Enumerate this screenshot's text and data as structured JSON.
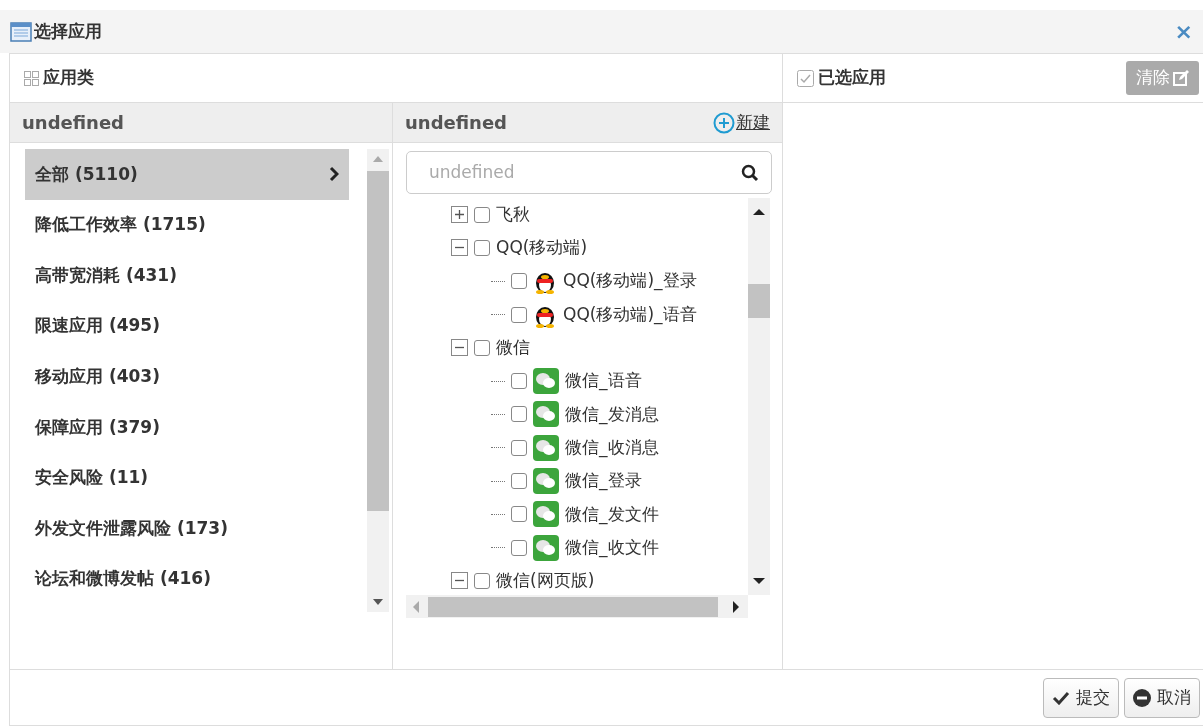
{
  "window": {
    "title": "选择应用",
    "close": "×"
  },
  "category_panel": {
    "title": "应用类"
  },
  "selected_panel": {
    "title": "已选应用",
    "clear_button": "清除"
  },
  "category_list": {
    "header": "undefined",
    "items": [
      {
        "label": "全部 (5110)",
        "selected": true
      },
      {
        "label": "降低工作效率 (1715)",
        "selected": false
      },
      {
        "label": "高带宽消耗 (431)",
        "selected": false
      },
      {
        "label": "限速应用 (495)",
        "selected": false
      },
      {
        "label": "移动应用 (403)",
        "selected": false
      },
      {
        "label": "保障应用 (379)",
        "selected": false
      },
      {
        "label": "安全风险 (11)",
        "selected": false
      },
      {
        "label": "外发文件泄露风险 (173)",
        "selected": false
      },
      {
        "label": "论坛和微博发帖 (416)",
        "selected": false
      }
    ]
  },
  "app_tree": {
    "header": "undefined",
    "new_link": "新建",
    "search": {
      "placeholder": "undefined"
    },
    "nodes": [
      {
        "label": "飞秋",
        "expanded": false,
        "checked": false
      },
      {
        "label": "QQ(移动端)",
        "expanded": true,
        "checked": false,
        "children": [
          {
            "label": "QQ(移动端)_登录",
            "checked": false,
            "kind": "qq"
          },
          {
            "label": "QQ(移动端)_语音",
            "checked": false,
            "kind": "qq"
          }
        ]
      },
      {
        "label": "微信",
        "expanded": true,
        "checked": false,
        "children": [
          {
            "label": "微信_语音",
            "checked": false,
            "kind": "wechat"
          },
          {
            "label": "微信_发消息",
            "checked": false,
            "kind": "wechat"
          },
          {
            "label": "微信_收消息",
            "checked": false,
            "kind": "wechat"
          },
          {
            "label": "微信_登录",
            "checked": false,
            "kind": "wechat"
          },
          {
            "label": "微信_发文件",
            "checked": false,
            "kind": "wechat"
          },
          {
            "label": "微信_收文件",
            "checked": false,
            "kind": "wechat"
          }
        ]
      },
      {
        "label": "微信(网页版)",
        "expanded": true,
        "checked": false
      }
    ]
  },
  "footer": {
    "buttons": [
      {
        "label": "提交",
        "kind": "submit"
      },
      {
        "label": "取消",
        "kind": "cancel"
      }
    ]
  }
}
